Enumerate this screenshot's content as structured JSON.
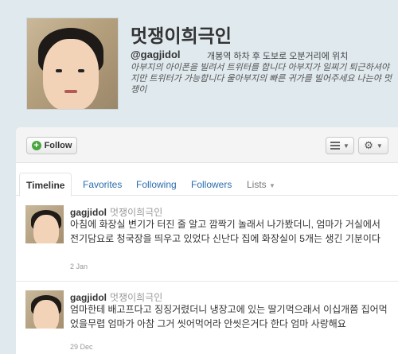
{
  "profile": {
    "name": "멋쟁이희극인",
    "screen_name": "@gagjidol",
    "location": "개봉역 하차 후 도보로 오분거리에 위치",
    "bio": "아부지의 아이폰을 빌려서 트위터를 합니다 아부지가 일찌기 퇴근하셔야지만 트위터가 가능합니다 울아부지의 빠른 귀가를 빌어주세요 나는야 멋쟁이"
  },
  "actions": {
    "follow_label": "Follow"
  },
  "tabs": [
    {
      "label": "Timeline"
    },
    {
      "label": "Favorites"
    },
    {
      "label": "Following"
    },
    {
      "label": "Followers"
    },
    {
      "label": "Lists"
    }
  ],
  "tweets": [
    {
      "screen_name": "gagjidol",
      "name": "멋쟁이희극인",
      "text": "아침에 화장실 변기가 터진 줄 알고 깜짝기 놀래서 나가봤더니, 엄마가 거실에서 전기담요로 청국장을 띄우고 있었다 신난다 집에 화장실이 5개는 생긴 기분이다",
      "date": "2 Jan"
    },
    {
      "screen_name": "gagjidol",
      "name": "멋쟁이희극인",
      "text": "엄마한테 배고프다고 징징거렸더니 냉장고에 있는 딸기먹으래서 이십개쯤 집어먹었을무렵 엄마가 아참 그거 씻어먹어라 안씻은거다 한다 엄마 사랑해요",
      "date": "29 Dec"
    }
  ],
  "colors": {
    "background": "#dfe9ee",
    "link": "#2a6dad",
    "follow_plus": "#4aa53f"
  }
}
